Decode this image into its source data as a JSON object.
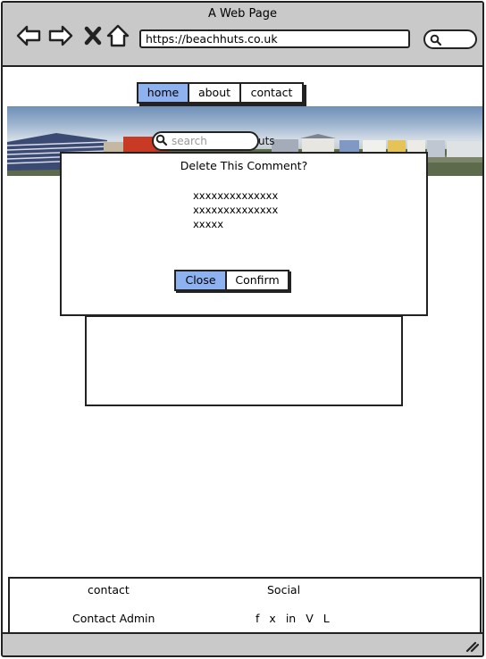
{
  "window": {
    "title": "A Web Page"
  },
  "browser": {
    "url": "https://beachhuts.co.uk",
    "icons": [
      "back-arrow-icon",
      "forward-arrow-icon",
      "stop-icon",
      "home-icon",
      "search-icon"
    ]
  },
  "nav": {
    "items": [
      {
        "label": "home",
        "active": true
      },
      {
        "label": "about",
        "active": false
      },
      {
        "label": "contact",
        "active": false
      }
    ],
    "active_color": "#8db2ef"
  },
  "hero": {
    "search_placeholder": "search",
    "partial_text": "uts"
  },
  "modal": {
    "title": "Delete This Comment?",
    "body_lines": [
      "xxxxxxxxxxxxxx",
      "xxxxxxxxxxxxxx",
      "xxxxx"
    ],
    "close_label": "Close",
    "confirm_label": "Confirm"
  },
  "footer": {
    "contact_heading": "contact",
    "contact_admin": "Contact Admin",
    "social_heading": "Social",
    "social_links": [
      "f",
      "x",
      "in",
      "V",
      "L"
    ]
  },
  "colors": {
    "chrome": "#c9c9c9",
    "accent": "#8db2ef"
  }
}
